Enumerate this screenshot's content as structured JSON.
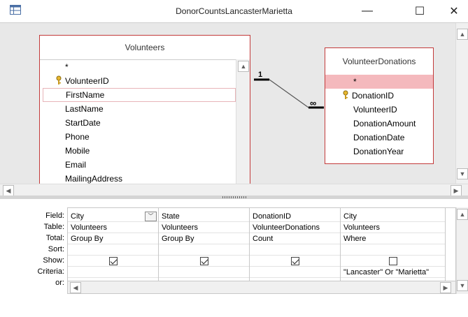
{
  "window": {
    "title": "DonorCountsLancasterMarietta",
    "minimize_glyph": "—",
    "maximize_glyph": "☐",
    "close_glyph": "✕"
  },
  "tables": [
    {
      "name": "Volunteers",
      "fields": [
        {
          "label": "*",
          "key": false
        },
        {
          "label": "VolunteerID",
          "key": true
        },
        {
          "label": "FirstName",
          "key": false
        },
        {
          "label": "LastName",
          "key": false
        },
        {
          "label": "StartDate",
          "key": false
        },
        {
          "label": "Phone",
          "key": false
        },
        {
          "label": "Mobile",
          "key": false
        },
        {
          "label": "Email",
          "key": false
        },
        {
          "label": "MailingAddress",
          "key": false
        }
      ]
    },
    {
      "name": "VolunteerDonations",
      "fields": [
        {
          "label": "*",
          "key": false
        },
        {
          "label": "DonationID",
          "key": true
        },
        {
          "label": "VolunteerID",
          "key": false
        },
        {
          "label": "DonationAmount",
          "key": false
        },
        {
          "label": "DonationDate",
          "key": false
        },
        {
          "label": "DonationYear",
          "key": false
        }
      ]
    }
  ],
  "relationship": {
    "one_label": "1",
    "many_label": "∞"
  },
  "grid": {
    "row_labels": [
      "Field:",
      "Table:",
      "Total:",
      "Sort:",
      "Show:",
      "Criteria:",
      "or:"
    ],
    "columns": [
      {
        "field": "City",
        "table": "Volunteers",
        "total": "Group By",
        "sort": "",
        "show": true,
        "criteria": "",
        "or": ""
      },
      {
        "field": "State",
        "table": "Volunteers",
        "total": "Group By",
        "sort": "",
        "show": true,
        "criteria": "",
        "or": ""
      },
      {
        "field": "DonationID",
        "table": "VolunteerDonations",
        "total": "Count",
        "sort": "",
        "show": true,
        "criteria": "",
        "or": ""
      },
      {
        "field": "City",
        "table": "Volunteers",
        "total": "Where",
        "sort": "",
        "show": false,
        "criteria": "\"Lancaster\" Or \"Marietta\"",
        "or": ""
      }
    ]
  },
  "icons": {
    "app": "query-design-icon",
    "key": "primary-key-icon",
    "dropdown": "chevron-down-icon",
    "scroll_up": "arrow-up-icon",
    "scroll_down": "arrow-down-icon",
    "scroll_left": "arrow-left-icon",
    "scroll_right": "arrow-right-icon"
  },
  "colors": {
    "table_border": "#c33a3a",
    "selected_row": "#f4b9bd",
    "pane_bg": "#e8e8e8"
  }
}
